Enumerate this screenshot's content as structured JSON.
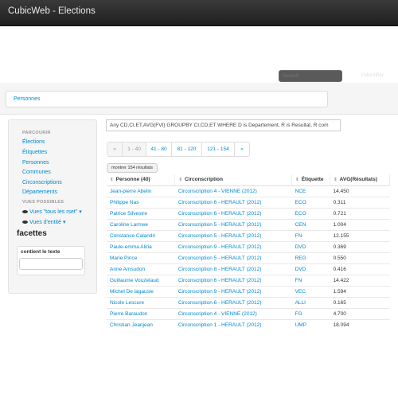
{
  "app": {
    "title": "CubicWeb - Elections",
    "search_placeholder": "Search",
    "login_label": "s'identifier"
  },
  "breadcrumb": {
    "current": "Personnes"
  },
  "sidebar": {
    "header_parcourir": "PARCOURIR",
    "links": [
      "Élections",
      "Étiquettes",
      "Personnes",
      "Communes",
      "Circonscriptions",
      "Départements"
    ],
    "header_vues": "VUES POSSIBLES",
    "vues": [
      "Vues \"tous les rset\"",
      "Vues d'entité"
    ],
    "facettes_title": "facettes",
    "facet_label": "contient le texte"
  },
  "main": {
    "rql": "Any CD,CI,ET,AVG(FVI) GROUPBY CI,CD,ET WHERE D is Departement, R is Resultat, R com",
    "pager": [
      {
        "label": "«",
        "disabled": true
      },
      {
        "label": "1 - 40",
        "disabled": true
      },
      {
        "label": "41 - 80",
        "disabled": false
      },
      {
        "label": "81 - 120",
        "disabled": false
      },
      {
        "label": "121 - 154",
        "disabled": false
      },
      {
        "label": "»",
        "disabled": false
      }
    ],
    "show_all_label": "montrer 154 résultats",
    "table": {
      "headers": [
        "Personne (40)",
        "Circonscription",
        "Étiquette",
        "AVG(Résultats)"
      ],
      "rows": [
        [
          "Jean-pierre Abelin",
          "Circonscription 4 - VIENNE (2012)",
          "NCE",
          "14.450"
        ],
        [
          "Philippe Nas",
          "Circonscription 6 - HERAULT (2012)",
          "ECO",
          "0.311"
        ],
        [
          "Patrice Silvestre",
          "Circonscription 6 - HERAULT (2012)",
          "ECO",
          "0.721"
        ],
        [
          "Caroline Larmee",
          "Circonscription 5 - HERAULT (2012)",
          "CEN",
          "1.004"
        ],
        [
          "Constance Calandri",
          "Circonscription 5 - HERAULT (2012)",
          "FN",
          "12.155"
        ],
        [
          "Paule-emma Aliria",
          "Circonscription 9 - HERAULT (2012)",
          "DVD",
          "0.369"
        ],
        [
          "Marie Pince",
          "Circonscription 5 - HERAULT (2012)",
          "REG",
          "0.550"
        ],
        [
          "Anne Amsudon",
          "Circonscription 8 - HERAULT (2012)",
          "DVD",
          "0.416"
        ],
        [
          "Guillaume Vouzelaud",
          "Circonscription 6 - HERAULT (2012)",
          "FN",
          "14.422"
        ],
        [
          "Michel De lagausie",
          "Circonscription 9 - HERAULT (2012)",
          "VEC",
          "1.594"
        ],
        [
          "Nicole Lescure",
          "Circonscription 6 - HERAULT (2012)",
          "ALLI",
          "0.165"
        ],
        [
          "Pierre Baraudon",
          "Circonscription 4 - VIENNE (2012)",
          "FG",
          "4.700"
        ],
        [
          "Christian Jeanjean",
          "Circonscription 1 - HERAULT (2012)",
          "UMP",
          "18.094"
        ]
      ]
    }
  }
}
